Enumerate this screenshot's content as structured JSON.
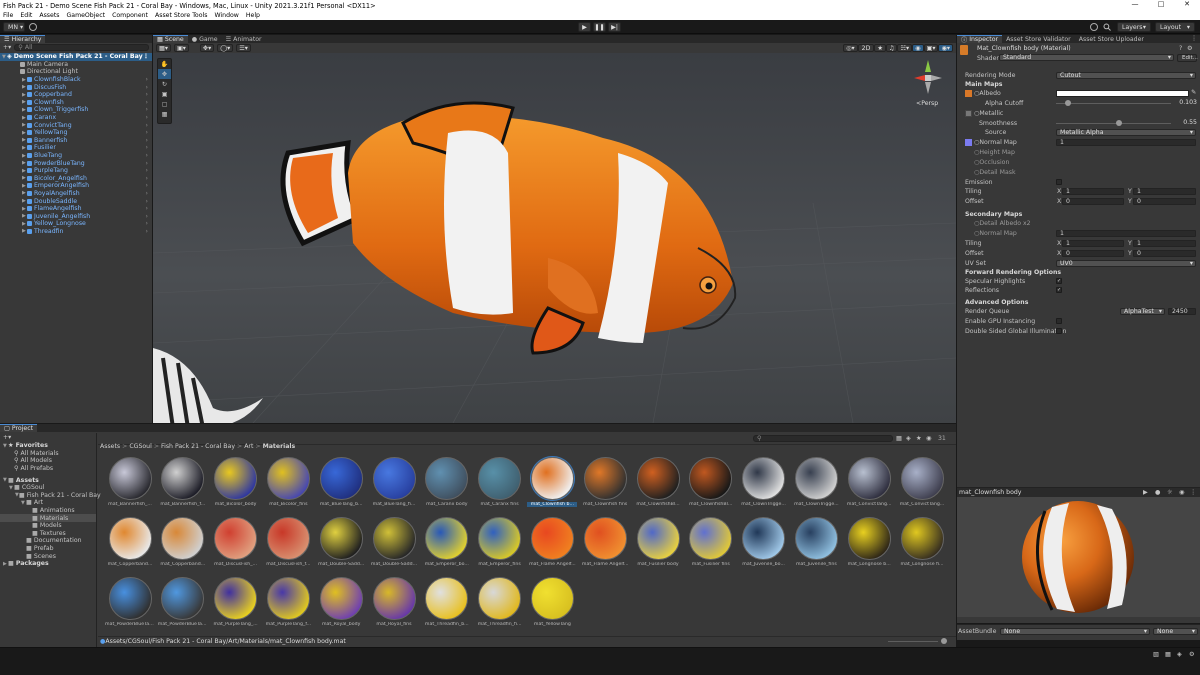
{
  "window": {
    "title": "Fish Pack 21 - Demo Scene Fish Pack 21 - Coral Bay - Windows, Mac, Linux - Unity 2021.3.21f1 Personal <DX11>"
  },
  "menu": [
    "File",
    "Edit",
    "Assets",
    "GameObject",
    "Component",
    "Asset Store Tools",
    "Window",
    "Help"
  ],
  "toolbar": {
    "account": "MN",
    "layers": "Layers",
    "layout": "Layout"
  },
  "hierarchy": {
    "tab": "Hierarchy",
    "search_placeholder": "All",
    "scene": "Demo Scene Fish Pack 21 - Coral Bay",
    "objects": [
      "Main Camera",
      "Directional Light"
    ],
    "fish": [
      "ClownfishBlack",
      "DiscusFish",
      "Copperband",
      "Clownfish",
      "Clown_Triggerfish",
      "Caranx",
      "ConvictTang",
      "YellowTang",
      "Bannerfish",
      "Fusilier",
      "BlueTang",
      "PowderBlueTang",
      "PurpleTang",
      "Bicolor_Angelfish",
      "EmperorAngelfish",
      "RoyalAngelfish",
      "DoubleSaddle",
      "FlameAngelfish",
      "Juvenile_Angelfish",
      "Yellow_Longnose",
      "Threadfin"
    ]
  },
  "scene_view": {
    "tabs": [
      "Scene",
      "Game",
      "Animator"
    ],
    "toolbar": {
      "mode": "2D",
      "view_label": "Persp"
    }
  },
  "inspector": {
    "tabs": [
      "Inspector",
      "Asset Store Validator",
      "Asset Store Uploader"
    ],
    "material_name": "Mat_Clownfish body (Material)",
    "shader_label": "Shader",
    "shader_value": "Standard",
    "edit_button": "Edit...",
    "rendering_mode_label": "Rendering Mode",
    "rendering_mode": "Cutout",
    "main_maps": "Main Maps",
    "albedo": "Albedo",
    "alpha_cutoff_label": "Alpha Cutoff",
    "alpha_cutoff": "0.103",
    "alpha_cutoff_frac": 0.103,
    "metallic": "Metallic",
    "smoothness_label": "Smoothness",
    "smoothness": "0.55",
    "smoothness_frac": 0.55,
    "source_label": "Source",
    "source_value": "Metallic Alpha",
    "normal_map": "Normal Map",
    "normal_value": "1",
    "height_map": "Height Map",
    "occlusion": "Occlusion",
    "detail_mask": "Detail Mask",
    "emission": "Emission",
    "tiling": "Tiling",
    "offset": "Offset",
    "x": "X",
    "y": "Y",
    "tiling_x": "1",
    "tiling_y": "1",
    "offset_x": "0",
    "offset_y": "0",
    "secondary_maps": "Secondary Maps",
    "detail_albedo": "Detail Albedo x2",
    "normal_map2": "Normal Map",
    "normal2_value": "1",
    "uv_set_label": "UV Set",
    "uv_set": "UV0",
    "forward_options": "Forward Rendering Options",
    "specular": "Specular Highlights",
    "reflections": "Reflections",
    "advanced": "Advanced Options",
    "render_queue": "Render Queue",
    "render_queue_mode": "AlphaTest",
    "render_queue_value": "2450",
    "gpu_instancing": "Enable GPU Instancing",
    "double_sided_gi": "Double Sided Global Illumination",
    "preview_title": "mat_Clownfish body",
    "asset_bundle_label": "AssetBundle",
    "asset_bundle": "None",
    "asset_bundle_variant": "None"
  },
  "project": {
    "tab": "Project",
    "favorites_label": "Favorites",
    "favorites": [
      "All Materials",
      "All Models",
      "All Prefabs"
    ],
    "assets_label": "Assets",
    "tree": [
      {
        "label": "CGSoul",
        "depth": 1
      },
      {
        "label": "Fish Pack 21 - Coral Bay",
        "depth": 2
      },
      {
        "label": "Art",
        "depth": 3
      },
      {
        "label": "Animations",
        "depth": 4
      },
      {
        "label": "Materials",
        "depth": 4
      },
      {
        "label": "Models",
        "depth": 4
      },
      {
        "label": "Textures",
        "depth": 4
      },
      {
        "label": "Documentation",
        "depth": 3
      },
      {
        "label": "Prefab",
        "depth": 3
      },
      {
        "label": "Scenes",
        "depth": 3
      }
    ],
    "packages_label": "Packages",
    "breadcrumb": [
      "Assets",
      "CGSoul",
      "Fish Pack 21 - Coral Bay",
      "Art",
      "Materials"
    ],
    "count_badge": "31",
    "status_path": "Assets/CGSoul/Fish Pack 21 - Coral Bay/Art/Materials/mat_Clownfish body.mat",
    "materials": [
      {
        "name": "mat_Bannerfish_...",
        "c1": "#c8c8d8",
        "c2": "#2a2a30"
      },
      {
        "name": "mat_Bannerfish_f...",
        "c1": "#d0d0d0",
        "c2": "#1e1e28"
      },
      {
        "name": "mat_Bicolor_body",
        "c1": "#e8c820",
        "c2": "#3038a0"
      },
      {
        "name": "mat_Bicolor_fins",
        "c1": "#e0c020",
        "c2": "#4848b0"
      },
      {
        "name": "mat_BlueTang_b...",
        "c1": "#3868d8",
        "c2": "#203080"
      },
      {
        "name": "mat_BlueTang_fi...",
        "c1": "#4878e0",
        "c2": "#2840a0"
      },
      {
        "name": "mat_Caranx body",
        "c1": "#6090b0",
        "c2": "#405060"
      },
      {
        "name": "mat_Caranx fins",
        "c1": "#5890a8",
        "c2": "#406070"
      },
      {
        "name": "mat_Clownfish b...",
        "c1": "#e07020",
        "c2": "#f0f0f0"
      },
      {
        "name": "mat_Clownfish fins",
        "c1": "#e07828",
        "c2": "#303030"
      },
      {
        "name": "mat_ClownfishBl...",
        "c1": "#d06020",
        "c2": "#202020"
      },
      {
        "name": "mat_ClownfishBl...",
        "c1": "#c05820",
        "c2": "#181818"
      },
      {
        "name": "mat_ClownTrigge...",
        "c1": "#303848",
        "c2": "#e0e0e0"
      },
      {
        "name": "mat_ClownTrigge...",
        "c1": "#384050",
        "c2": "#d0d0d0"
      },
      {
        "name": "mat_ConvictTang...",
        "c1": "#b8c0d0",
        "c2": "#303040"
      },
      {
        "name": "mat_ConvictTang...",
        "c1": "#a8b0c8",
        "c2": "#404050"
      },
      {
        "name": "mat_Copperband...",
        "c1": "#e08830",
        "c2": "#e8e8e8"
      },
      {
        "name": "mat_Copperband...",
        "c1": "#d88838",
        "c2": "#d0d0d0"
      },
      {
        "name": "mat_DiscusFish_...",
        "c1": "#d04030",
        "c2": "#e0a080"
      },
      {
        "name": "mat_DiscusFish_f...",
        "c1": "#c83828",
        "c2": "#d89070"
      },
      {
        "name": "mat_Double-Sadd...",
        "c1": "#e0d040",
        "c2": "#202020"
      },
      {
        "name": "mat_Double-Sadd...",
        "c1": "#d0c038",
        "c2": "#282828"
      },
      {
        "name": "mat_Emperor_bo...",
        "c1": "#2858b8",
        "c2": "#e0d030"
      },
      {
        "name": "mat_Emperor_fins",
        "c1": "#3060c0",
        "c2": "#d8c828"
      },
      {
        "name": "mat_Flame Angelf...",
        "c1": "#e84820",
        "c2": "#f08020"
      },
      {
        "name": "mat_Flame Angelf...",
        "c1": "#e05020",
        "c2": "#f09030"
      },
      {
        "name": "mat_Fusilier body",
        "c1": "#5068c8",
        "c2": "#e8d040"
      },
      {
        "name": "mat_Fusilier fins",
        "c1": "#6070d0",
        "c2": "#e0c838"
      },
      {
        "name": "mat_Juvenile_bo...",
        "c1": "#203858",
        "c2": "#a0c8e8"
      },
      {
        "name": "mat_Juvenile_fins",
        "c1": "#284060",
        "c2": "#90c0e0"
      },
      {
        "name": "mat_Longnose b...",
        "c1": "#e8d020",
        "c2": "#302818"
      },
      {
        "name": "mat_Longnose fi...",
        "c1": "#e0c820",
        "c2": "#383020"
      },
      {
        "name": "mat_PowderBlueTan...",
        "c1": "#4890e0",
        "c2": "#303030"
      },
      {
        "name": "mat_PowderBlueTan...",
        "c1": "#5098e0",
        "c2": "#383838"
      },
      {
        "name": "mat_PurpleTang_...",
        "c1": "#4030a0",
        "c2": "#e8d020"
      },
      {
        "name": "mat_PurpleTang_f...",
        "c1": "#4838a8",
        "c2": "#e0c820"
      },
      {
        "name": "mat_Royal_body",
        "c1": "#e0c020",
        "c2": "#7040b0"
      },
      {
        "name": "mat_Royal_fins",
        "c1": "#d8b828",
        "c2": "#6838a8"
      },
      {
        "name": "mat_Threadfin_b...",
        "c1": "#e0e0e0",
        "c2": "#e8c020"
      },
      {
        "name": "mat_Threadfin_fi...",
        "c1": "#d8d8d8",
        "c2": "#e0b820"
      },
      {
        "name": "mat_YellowTang",
        "c1": "#f0e030",
        "c2": "#d8c020"
      }
    ]
  },
  "colors": {
    "accent": "#3a79bb",
    "link": "#7ab6ff",
    "bg": "#383838",
    "clown_orange": "#e8761e"
  }
}
